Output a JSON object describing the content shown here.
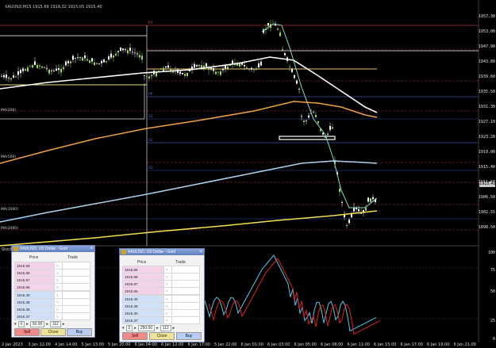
{
  "header": {
    "symbol_line": "XAUUSD,M15  1915.69 1916.32 1915.05 1915.40",
    "subwindow_label": "Stoch(5,3,3)"
  },
  "price_axis": {
    "labels": [
      "1957.30",
      "1953.00",
      "1947.90",
      "1943.80",
      "1939.60",
      "1935.50",
      "1931.30",
      "1927.10",
      "1923.20",
      "1919.00",
      "1915.40",
      "1911.60",
      "1906.50",
      "1902.55",
      "1898.50"
    ],
    "current_price": "1915.40"
  },
  "stoch_axis": {
    "labels": [
      "100",
      "75",
      "50",
      "25",
      "0"
    ]
  },
  "time_axis": {
    "labels": [
      "2 Jan 2023",
      "3 Jan 12:00",
      "4 Jan 14:00",
      "5 Jan 13:00",
      "5 Jan 20:00",
      "6 Jan 04:00",
      "6 Jan 12:00",
      "6 Jan 17:00",
      "5 Jan 22:00",
      "6 Jan 01:00",
      "6 Jan 03:00",
      "6 Jan 05:00",
      "6 Jan 08:00",
      "6 Jan 11:00",
      "6 Jan 15:00",
      "6 Jan 17:00",
      "6 Jan 19:00",
      "6 Jan 21:00"
    ]
  },
  "level_labels": {
    "pivot": [
      "R1",
      "PP",
      "S1",
      "S2",
      "S3"
    ],
    "left_notes": [
      "MA(200)",
      "MA(500)",
      "MA(1000)",
      "MA(2000)"
    ]
  },
  "colors": {
    "background": "#000000",
    "bull_candle": "#9bd85a",
    "bear_candle": "#ffffff",
    "ma_white": "#ffffff",
    "ma_cyan": "#7fe0c8",
    "ma_orange": "#f0a040",
    "ma_lightblue": "#a8d4f0",
    "ma_yellow": "#f2e050",
    "stoch_main": "#56c8f0",
    "stoch_signal": "#e02020",
    "resistance": "#b03030",
    "support": "#3050b0"
  },
  "dom_windows": [
    {
      "title": "XAUUSD, US Dollar - Gold",
      "col_price": "Price",
      "col_trade": "Trade",
      "asks": [
        "1915.69",
        "1915.68",
        "1915.67",
        "1915.66"
      ],
      "bids": [
        "1915.40",
        "1915.39",
        "1915.38",
        "1915.37"
      ],
      "volume": "0",
      "deviation": "50.00",
      "lots": "112",
      "sell": "Sell",
      "close": "Close",
      "buy": "Buy"
    },
    {
      "title": "XAUUSD, US Dollar - Gold",
      "col_price": "Price",
      "col_trade": "Trade",
      "asks": [
        "1915.69",
        "1915.68",
        "1915.67",
        "1915.66"
      ],
      "bids": [
        "1915.40",
        "1915.39",
        "1915.30",
        "1915.37"
      ],
      "volume": "0",
      "deviation": "250.00",
      "lots": "112",
      "sell": "Sell",
      "close": "Close",
      "buy": "Buy"
    }
  ]
}
